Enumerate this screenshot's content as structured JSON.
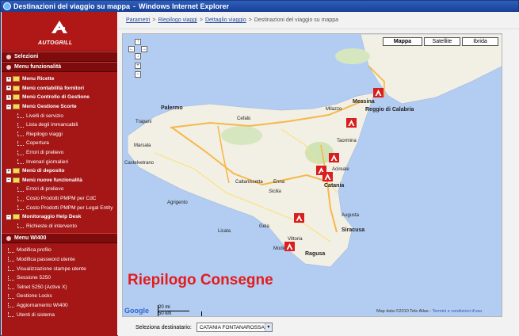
{
  "window": {
    "title": "Destinazioni del viaggio su mappa",
    "app": "Windows Internet Explorer"
  },
  "sidebar": {
    "brand": "AUTOGRILL",
    "sections": {
      "selezioni": "Selezioni",
      "menu_funz": "Menu funzionalità",
      "menu_wi400": "Menu WI400"
    },
    "items": [
      {
        "label": "Menu Ricette",
        "type": "folder"
      },
      {
        "label": "Menù contabilità fornitori",
        "type": "folder"
      },
      {
        "label": "Menù Controllo di Gestione",
        "type": "folder"
      },
      {
        "label": "Menù Gestione Scorte",
        "type": "folder-open"
      },
      {
        "label": "Livelli di servizio",
        "type": "sub"
      },
      {
        "label": "Lista degli immancabili",
        "type": "sub"
      },
      {
        "label": "Riepilogo viaggi",
        "type": "sub"
      },
      {
        "label": "Copertura",
        "type": "sub"
      },
      {
        "label": "Errori di prelievo",
        "type": "sub"
      },
      {
        "label": "Invenari giornalieri",
        "type": "sub"
      },
      {
        "label": "Menù di deposito",
        "type": "folder"
      },
      {
        "label": "Menù nuove funzionalità",
        "type": "folder-open"
      },
      {
        "label": "Errori di prelievo",
        "type": "sub"
      },
      {
        "label": "Costo Prodotti PMPM per CdC",
        "type": "sub"
      },
      {
        "label": "Costo Prodotti PMPM per Legal Entity",
        "type": "sub"
      },
      {
        "label": "Monitoraggio Help Desk",
        "type": "folder-open"
      },
      {
        "label": "Richieste di intervento",
        "type": "sub"
      }
    ],
    "wi400_items": [
      "Modifica profilo",
      "Modifica password utente",
      "Visualizzazione stampe utente",
      "Sessione 5250",
      "Telnet 5250 (Active X)",
      "Gestione Locks",
      "Aggiornamento WI400",
      "Utenti di sistema"
    ]
  },
  "breadcrumb": {
    "items": [
      "Parametri",
      "Riepilogo viaggi",
      "Dettaglio viaggio"
    ],
    "current": "Destinazioni del viaggio su mappa"
  },
  "map": {
    "types": [
      "Mappa",
      "Satellite",
      "Ibrida"
    ],
    "overlay_title": "Riepilogo Consegne",
    "scale_labels": [
      "20 mi",
      "50 km"
    ],
    "logo": "Google",
    "copyright": "Map data ©2010 Tele Atlas",
    "terms": "Termini e condizioni d'uso",
    "cities": [
      {
        "name": "Palermo",
        "big": true
      },
      {
        "name": "Messina",
        "big": true
      },
      {
        "name": "Reggio di Calabria",
        "big": true
      },
      {
        "name": "Catania",
        "big": true
      },
      {
        "name": "Siracusa",
        "big": true
      },
      {
        "name": "Ragusa",
        "big": true
      },
      {
        "name": "Agrigento",
        "big": false
      },
      {
        "name": "Caltanissetta",
        "big": false
      },
      {
        "name": "Marsala",
        "big": false
      },
      {
        "name": "Trapani",
        "big": false
      },
      {
        "name": "Enna",
        "big": false
      },
      {
        "name": "Gela",
        "big": false
      },
      {
        "name": "Modica",
        "big": false
      },
      {
        "name": "Sicilia",
        "big": false
      },
      {
        "name": "Cefalù",
        "big": false
      },
      {
        "name": "Castelvetrano",
        "big": false
      },
      {
        "name": "Licata",
        "big": false
      },
      {
        "name": "Vittoria",
        "big": false
      },
      {
        "name": "Acireale",
        "big": false
      },
      {
        "name": "Taormina",
        "big": false
      },
      {
        "name": "Milazzo",
        "big": false
      },
      {
        "name": "Augusta",
        "big": false
      }
    ]
  },
  "selector": {
    "label": "Seleziona destinatario:",
    "value": "CATANIA FONTANAROSSA"
  },
  "colors": {
    "sidebar": "#a51616",
    "overlay_title": "#e31c1c",
    "marker": "#d81e1e",
    "sea": "#b3cdf2",
    "land": "#f2efe4"
  }
}
